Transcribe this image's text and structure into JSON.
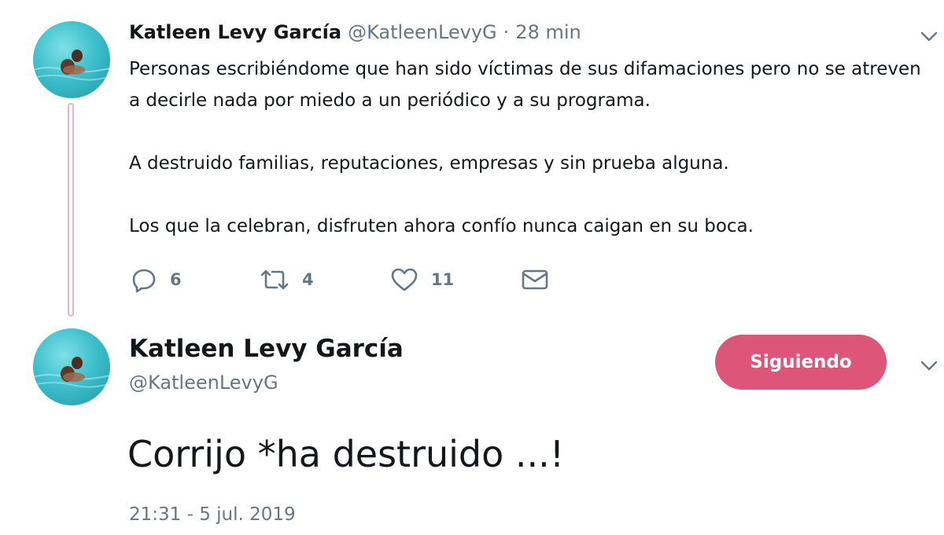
{
  "tweet1": {
    "author_name": "Katleen Levy García",
    "author_handle": "@KatleenLevyG",
    "separator": "·",
    "time_ago": "28 min",
    "paragraphs": [
      "Personas escribiéndome que han sido víctimas de sus difamaciones pero no se atreven a decirle nada por miedo a un periódico y a su programa.",
      "A destruido familias, reputaciones, empresas y sin prueba alguna.",
      "Los que la celebran, disfruten ahora confío nunca caigan en su boca."
    ],
    "actions": {
      "reply_count": "6",
      "retweet_count": "4",
      "like_count": "11"
    }
  },
  "tweet2": {
    "author_name": "Katleen Levy García",
    "author_handle": "@KatleenLevyG",
    "follow_button_label": "Siguiendo",
    "text": "Corrijo *ha destruido ...!",
    "timestamp": "21:31 - 5 jul. 2019"
  },
  "icons": {
    "reply": "reply-icon",
    "retweet": "retweet-icon",
    "like": "heart-icon",
    "dm": "envelope-icon",
    "more": "chevron-down-icon"
  },
  "colors": {
    "follow_button": "#dd5578",
    "thread_line": "#eab3c3",
    "secondary_text": "#657786",
    "primary_text": "#14171a"
  }
}
